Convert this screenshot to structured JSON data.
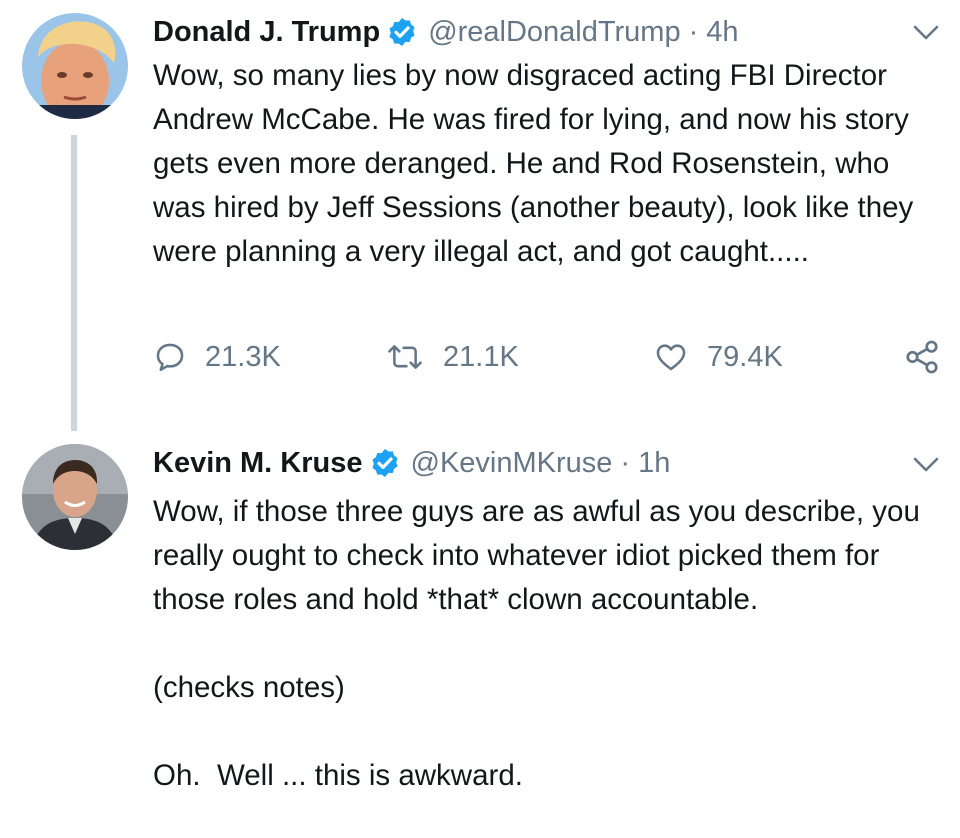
{
  "tweets": [
    {
      "name": "Donald J. Trump",
      "handle": "@realDonaldTrump",
      "separator": "·",
      "time": "4h",
      "verified": true,
      "avatar_icon": "profile-photo",
      "body": "Wow, so many lies by now disgraced acting FBI Director Andrew McCabe. He was fired for lying, and now his story gets even more deranged. He and Rod Rosenstein, who was hired by Jeff Sessions (another beauty), look like they were planning a very illegal act, and got caught.....",
      "actions": {
        "replies": "21.3K",
        "retweets": "21.1K",
        "likes": "79.4K"
      }
    },
    {
      "name": "Kevin M. Kruse",
      "handle": "@KevinMKruse",
      "separator": "·",
      "time": "1h",
      "verified": true,
      "avatar_icon": "profile-photo",
      "body_paragraphs": [
        "Wow, if those three guys are as awful as you describe, you really ought to check into whatever idiot picked them for those roles and hold *that* clown accountable.",
        "(checks notes)",
        "Oh.  Well ... this is awkward."
      ]
    }
  ],
  "colors": {
    "text": "#14171a",
    "muted": "#657786",
    "verified_blue": "#1da1f2",
    "thread_line": "#ccd6dd"
  }
}
